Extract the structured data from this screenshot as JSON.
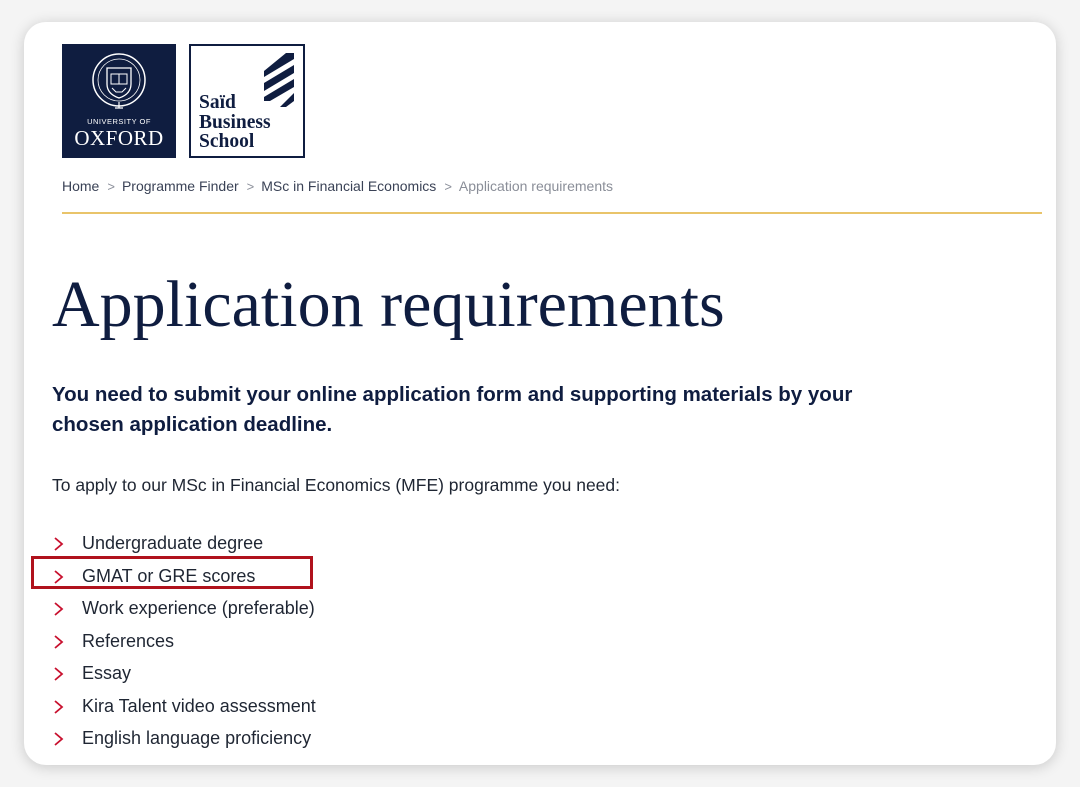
{
  "logos": {
    "oxford": {
      "small_text": "UNIVERSITY OF",
      "big_text": "OXFORD",
      "icon": "oxford-crest-icon",
      "color": "#0f1d40"
    },
    "said": {
      "lines": [
        "Saïd",
        "Business",
        "School"
      ],
      "icon": "said-stripes-icon",
      "color": "#0f1d40"
    }
  },
  "breadcrumb": {
    "items": [
      "Home",
      "Programme Finder",
      "MSc in Financial Economics"
    ],
    "current": "Application requirements",
    "separator": ">"
  },
  "page": {
    "title": "Application requirements",
    "lead": "You need to submit your online application form and supporting materials by your chosen application deadline.",
    "intro": "To apply to our MSc in Financial Economics (MFE) programme you need:"
  },
  "requirements": [
    "Undergraduate degree",
    "GMAT or GRE scores",
    "Work experience (preferable)",
    "References",
    "Essay",
    "Kira Talent video assessment",
    "English language proficiency"
  ],
  "highlighted_item": "GMAT or GRE scores",
  "colors": {
    "navy": "#0f1d40",
    "gold_rule": "#e9c46a",
    "chevron_red": "#c8102e",
    "highlight_red": "#b0121c"
  }
}
